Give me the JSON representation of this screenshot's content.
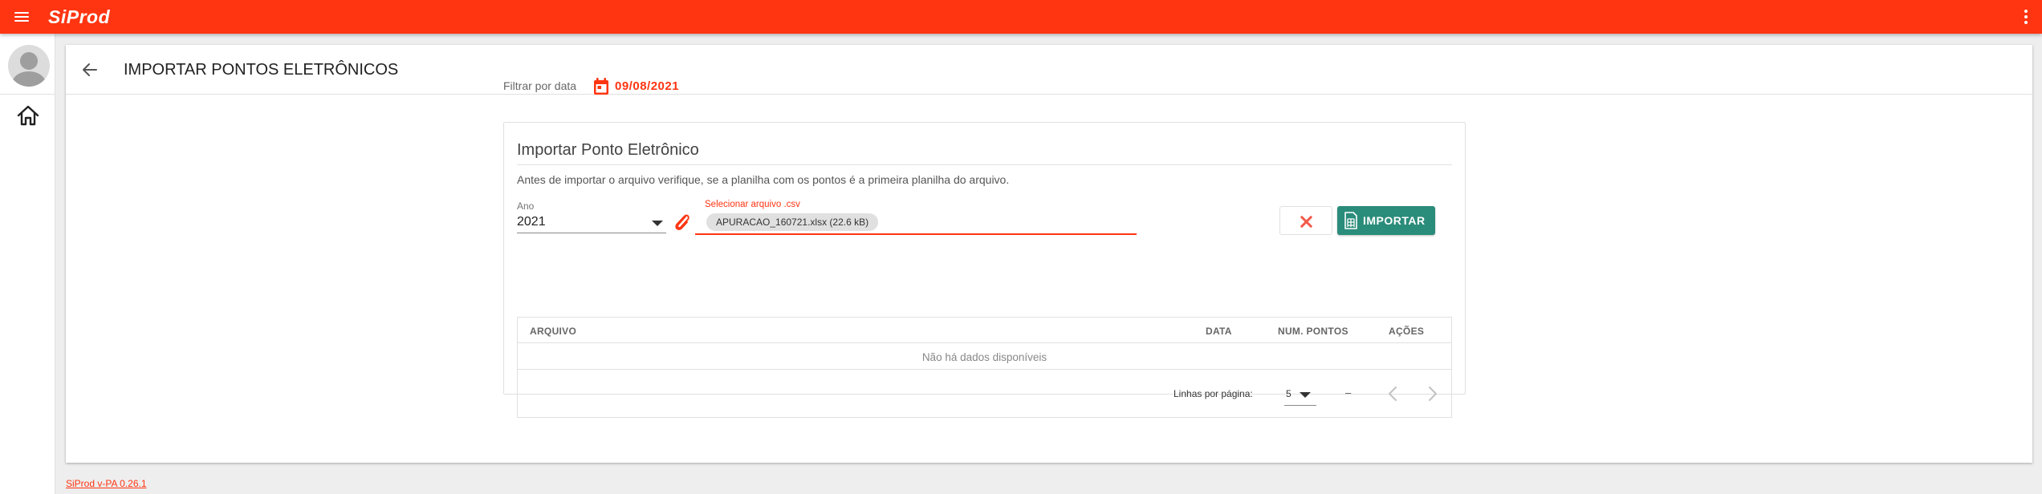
{
  "app": {
    "name": "SiProd"
  },
  "page": {
    "title": "IMPORTAR PONTOS ELETRÔNICOS"
  },
  "filter": {
    "label": "Filtrar por data",
    "date": "09/08/2021"
  },
  "panel": {
    "title": "Importar Ponto Eletrônico",
    "description": "Antes de importar o arquivo verifique, se a planilha com os pontos é a primeira planilha do arquivo."
  },
  "ano": {
    "label": "Ano",
    "value": "2021"
  },
  "file": {
    "label": "Selecionar arquivo .csv",
    "chip": "APURACAO_160721.xlsx (22.6 kB)"
  },
  "actions": {
    "import_label": "IMPORTAR"
  },
  "table": {
    "headers": [
      "ARQUIVO",
      "DATA",
      "NUM. PONTOS",
      "AÇÕES"
    ],
    "empty": "Não há dados disponíveis",
    "rows_per_page_label": "Linhas por página:",
    "rows_per_page": "5",
    "range": "–"
  },
  "footer": {
    "version": "SiProd v-PA 0.26.1"
  },
  "colors": {
    "primary": "#ff3512",
    "success": "#2a8c7a"
  },
  "icons": [
    "menu-icon",
    "more-vert-icon",
    "avatar-icon",
    "home-icon",
    "arrow-left-icon",
    "calendar-icon",
    "paperclip-icon",
    "close-icon",
    "spreadsheet-icon",
    "chevron-left-icon",
    "chevron-right-icon"
  ]
}
